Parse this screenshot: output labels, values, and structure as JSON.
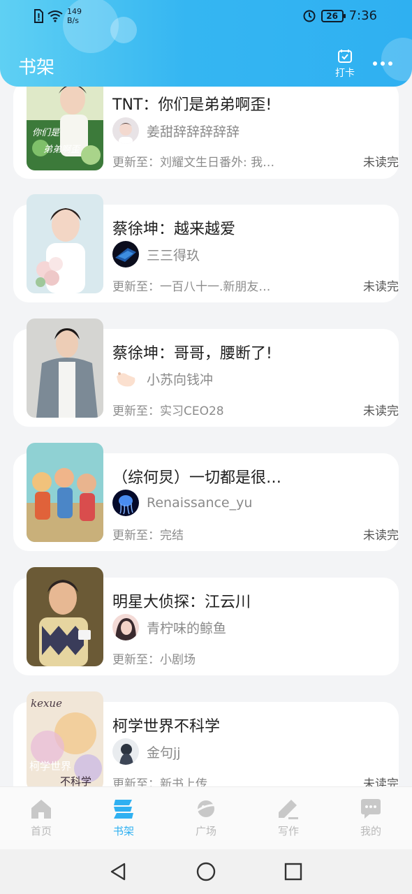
{
  "status_bar": {
    "net_speed_value": "149",
    "net_speed_unit": "B/s",
    "battery": "26",
    "time": "7:36"
  },
  "header": {
    "title": "书架",
    "checkin_label": "打卡"
  },
  "books": [
    {
      "title": "TNT：你们是弟弟啊歪!",
      "author": "姜甜辞辞辞辞辞",
      "update": "更新至：刘耀文生日番外: 我…",
      "status": "未读完"
    },
    {
      "title": "蔡徐坤：越来越爱",
      "author": "三三得玖",
      "update": "更新至：一百八十一.新朋友…",
      "status": "未读完"
    },
    {
      "title": "蔡徐坤：哥哥，腰断了!",
      "author": "小苏向钱冲",
      "update": "更新至：实习CEO28",
      "status": "未读完"
    },
    {
      "title": "（综何炅）一切都是很…",
      "author": "Renaissance_yu",
      "update": "更新至：完结",
      "status": "未读完"
    },
    {
      "title": "明星大侦探：江云川",
      "author": "青柠味的鲸鱼",
      "update": "更新至：小剧场",
      "status": ""
    },
    {
      "title": "柯学世界不科学",
      "author": "金句jj",
      "update": "更新至：新书上传",
      "status": "未读完"
    }
  ],
  "covers": {
    "cover1_text": "你们是弟弟啊歪",
    "cover6_text_top": "kexue",
    "cover6_text_bottom": "柯学世界 不科学"
  },
  "nav": {
    "items": [
      {
        "label": "首页"
      },
      {
        "label": "书架"
      },
      {
        "label": "广场"
      },
      {
        "label": "写作"
      },
      {
        "label": "我的"
      }
    ]
  },
  "colors": {
    "accent": "#2fb0f1",
    "header_start": "#5fd0f3",
    "inactive_nav": "#b9b9b9"
  }
}
